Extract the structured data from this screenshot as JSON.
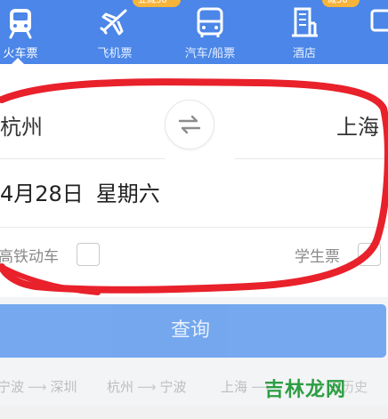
{
  "nav": {
    "tabs": [
      {
        "label": "火车票",
        "icon": "train-icon",
        "active": true
      },
      {
        "label": "飞机票",
        "icon": "plane-icon",
        "badge": "立减30"
      },
      {
        "label": "汽车/船票",
        "icon": "bus-icon"
      },
      {
        "label": "酒店",
        "icon": "hotel-icon",
        "badge": "减50"
      }
    ],
    "accent": "#4b86e8"
  },
  "search": {
    "from_city": "杭州",
    "to_city": "上海",
    "date": "4月28日",
    "weekday": "星期六",
    "options": {
      "gaotie_label": "高铁动车",
      "student_label": "学生票"
    },
    "button_label": "查询",
    "button_color": "#6ea3ee"
  },
  "history": {
    "routes": [
      {
        "from": "宁波",
        "to": "深圳"
      },
      {
        "from": "杭州",
        "to": "宁波"
      },
      {
        "from": "上海",
        "to": ""
      }
    ],
    "clear_label": "除历史"
  },
  "annotation": {
    "color": "#e8212b"
  },
  "watermark": {
    "text": "吉林龙网"
  }
}
